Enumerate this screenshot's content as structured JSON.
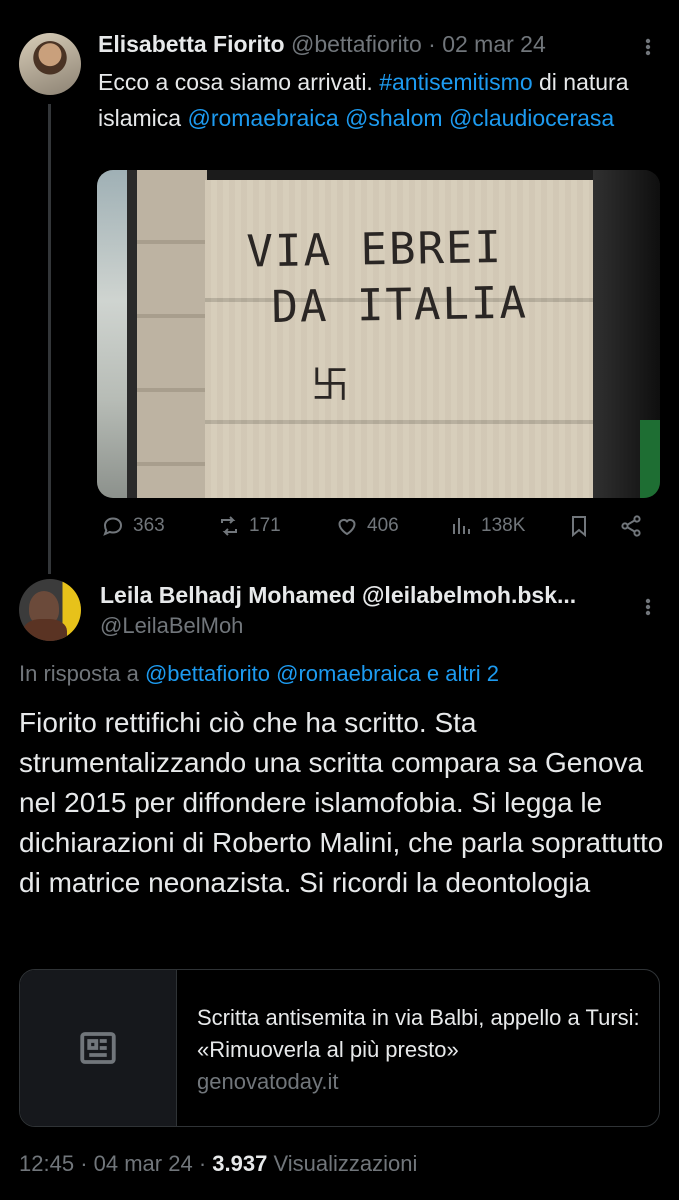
{
  "tweet1": {
    "name": "Elisabetta Fiorito",
    "handle": "@bettafiorito",
    "separator": "·",
    "date": "02 mar 24",
    "text_intro": "Ecco a cosa siamo arrivati. ",
    "hashtag": "#antisemitismo",
    "text_mid": " di natura islamica ",
    "mention1": "@romaebraica",
    "mention2": "@shalom",
    "mention3": "@claudiocerasa",
    "graffiti_line1": "VIA EBREI",
    "graffiti_line2": "DA ITALIA",
    "actions": {
      "replies": "363",
      "reposts": "171",
      "likes": "406",
      "views": "138K"
    }
  },
  "tweet2": {
    "name": "Leila Belhadj Mohamed @leilabelmoh.bsk...",
    "handle": "@LeilaBelMoh",
    "reply_prefix": "In risposta a ",
    "reply_mention1": "@bettafiorito",
    "reply_mention2": "@romaebraica",
    "reply_others": "e altri 2",
    "text": "Fiorito rettifichi ciò che ha scritto. Sta strumentalizzando una scritta compara sa Genova nel 2015 per diffondere islamofobia. Si legga le dichiarazioni di Roberto Malini, che parla soprattutto di matrice neonazista. Si ricordi la deontologia",
    "card": {
      "title": "Scritta antisemita in via Balbi, appello a Tursi: «Rimuoverla al più presto»",
      "domain": "genovatoday.it",
      "icon": "article-icon"
    },
    "time": "12:45",
    "separator": "·",
    "date": "04 mar 24",
    "views_count": "3.937",
    "views_label": "Visualizzazioni"
  },
  "colors": {
    "background": "#000000",
    "text": "#e7e9ea",
    "muted": "#71767b",
    "link": "#1d9bf0",
    "border": "#2f3336"
  }
}
